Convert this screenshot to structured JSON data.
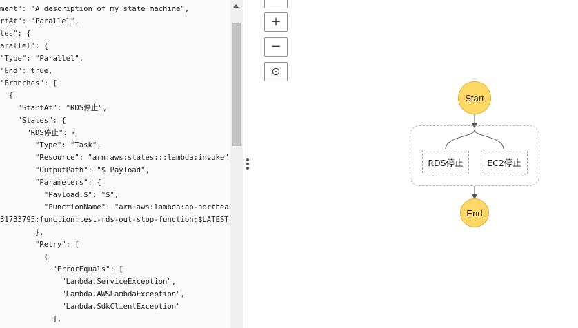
{
  "editor": {
    "lines": [
      {
        "t": "ment\": \"A description of my state machine\","
      },
      {
        "t": "rtAt\": \"Parallel\","
      },
      {
        "t": "tes\": {"
      },
      {
        "t": "arallel\": {"
      },
      {
        "t": "\"Type\": \"Parallel\","
      },
      {
        "t": "\"End\": true,"
      },
      {
        "t": "\"Branches\": ["
      },
      {
        "t": "  {"
      },
      {
        "t": "    \"StartAt\": \"RDS停止\","
      },
      {
        "t": "    \"States\": {"
      },
      {
        "t": "      \"RDS停止\": {"
      },
      {
        "t": "        \"Type\": \"Task\","
      },
      {
        "t": "        \"Resource\": \"arn:aws:states:::lambda:invoke\","
      },
      {
        "t": "        \"OutputPath\": \"$.Payload\","
      },
      {
        "t": "        \"Parameters\": {"
      },
      {
        "t": "          \"Payload.$\": \"$\","
      },
      {
        "t": "          \"FunctionName\": \"arn:aws:lambda:ap-northeast-"
      },
      {
        "t": "31733795:function:test-rds-out-stop-function:$LATEST\""
      },
      {
        "t": "        },"
      },
      {
        "t": "        \"Retry\": ["
      },
      {
        "t": "          {"
      },
      {
        "t": "            \"ErrorEquals\": ["
      },
      {
        "t": "              \"Lambda.ServiceException\","
      },
      {
        "t": "              \"Lambda.AWSLambdaException\","
      },
      {
        "t": "              \"Lambda.SdkClientException\""
      },
      {
        "t": "            ],"
      }
    ]
  },
  "graph": {
    "start_label": "Start",
    "end_label": "End",
    "branch1_label": "RDS停止",
    "branch2_label": "EC2停止"
  },
  "controls": {
    "zoom_in": "+",
    "zoom_out": "−",
    "center": "⊙"
  }
}
